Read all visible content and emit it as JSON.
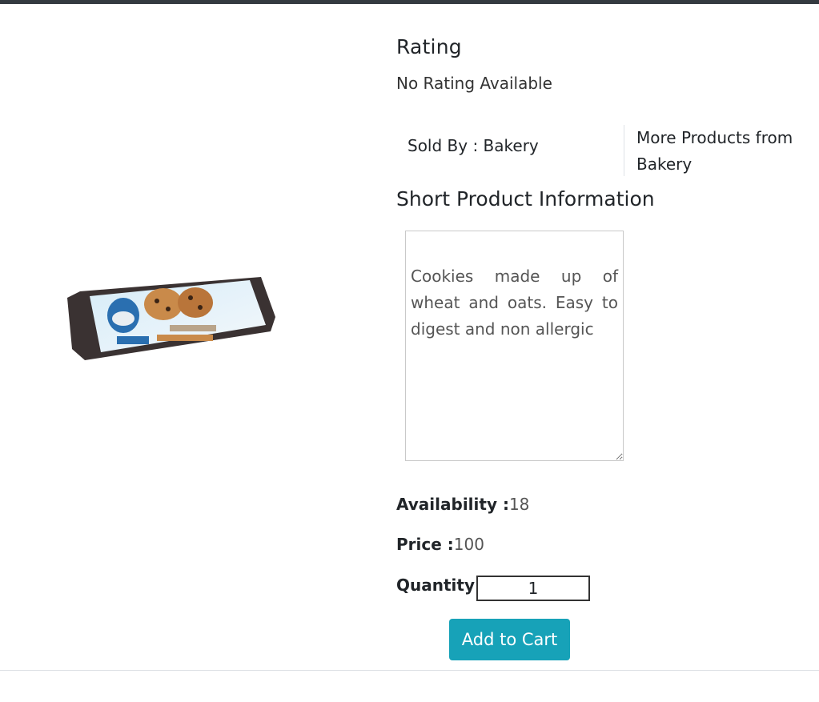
{
  "product": {
    "image_alt": "cookies-pack"
  },
  "rating": {
    "heading": "Rating",
    "value": "No Rating Available"
  },
  "seller": {
    "sold_by_label": "Sold By : Bakery",
    "more_products_link": "More Products from Bakery"
  },
  "short_info": {
    "heading": "Short Product Information",
    "text": "Cookies made up of wheat and oats. Easy to digest and non allergic"
  },
  "details": {
    "availability_label": "Availability :",
    "availability_value": "18",
    "price_label": "Price :",
    "price_value": "100",
    "quantity_label": "Quantity :",
    "quantity_value": "1"
  },
  "actions": {
    "add_to_cart": "Add to Cart"
  },
  "colors": {
    "accent": "#17a2b8",
    "topbar": "#343a40"
  }
}
